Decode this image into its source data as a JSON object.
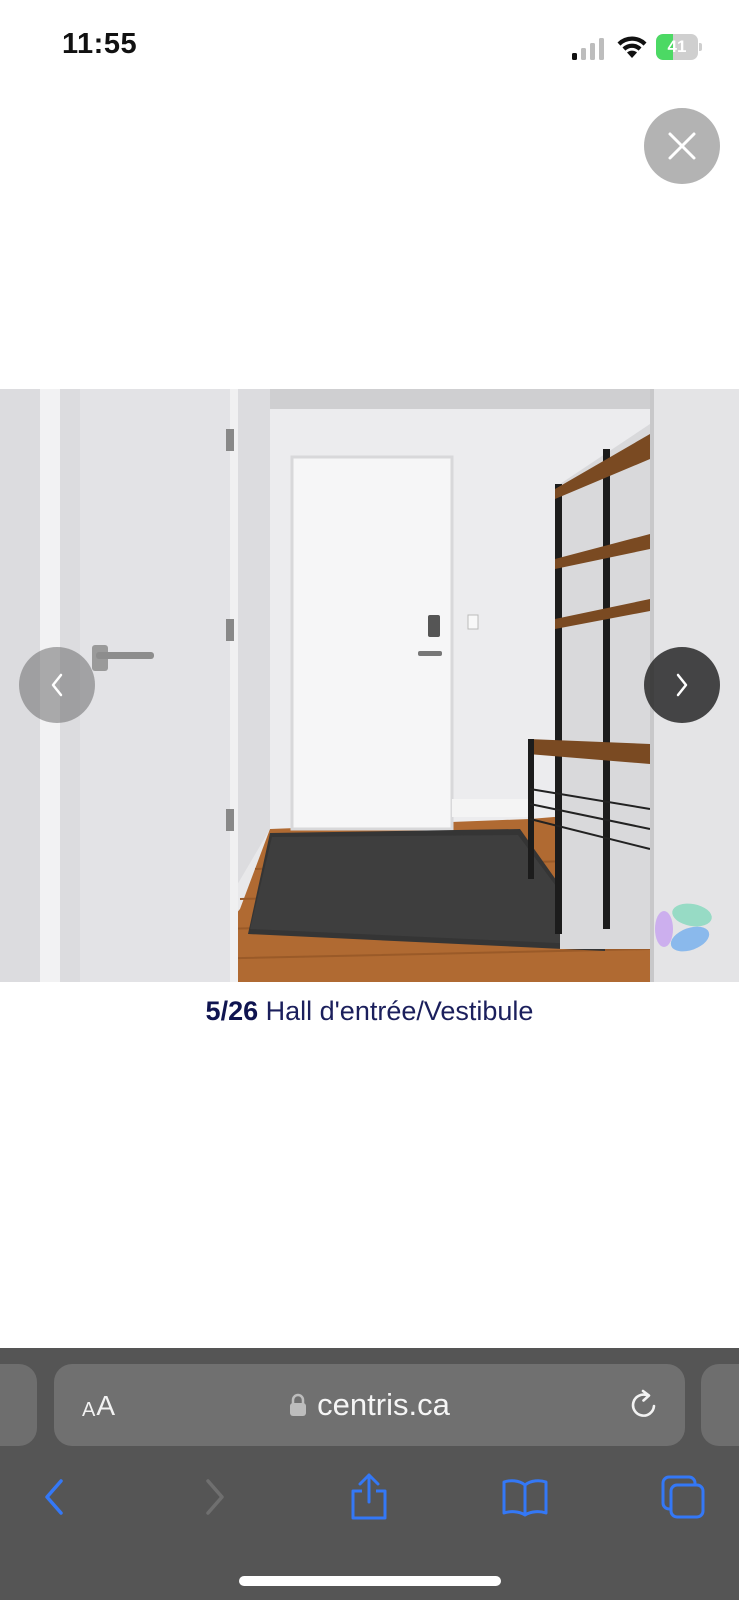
{
  "status_bar": {
    "time": "11:55",
    "battery": "41"
  },
  "photo": {
    "current": "5/26",
    "room_label": "Hall d'entrée/Vestibule"
  },
  "browser": {
    "text_size_small": "A",
    "text_size_large": "A",
    "url": "centris.ca"
  },
  "colors": {
    "caption": "#1b1f5c",
    "toolbar_bg": "#555555",
    "toolbar_icon": "#3478f6",
    "battery": "#4cd964"
  },
  "icons": {
    "close": "close-icon",
    "prev": "chevron-left-icon",
    "next": "chevron-right-icon",
    "back": "back-icon",
    "forward": "forward-icon",
    "share": "share-icon",
    "bookmarks": "book-icon",
    "tabs": "tabs-icon",
    "reload": "reload-icon",
    "lock": "lock-icon"
  }
}
